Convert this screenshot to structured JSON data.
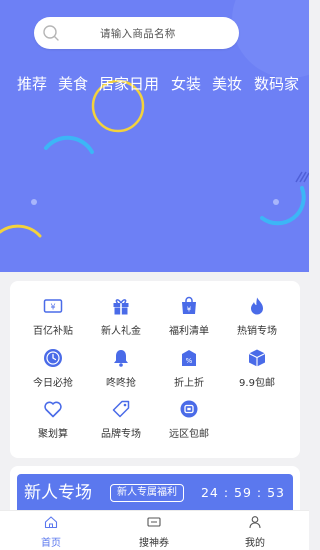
{
  "colors": {
    "accent": "#5b78ee",
    "hero_background": "#6d80f5",
    "ring": "#f3d23c"
  },
  "search": {
    "placeholder": "请输入商品名称",
    "icon": "search-icon"
  },
  "category_tabs": [
    {
      "label": "推荐"
    },
    {
      "label": "美食"
    },
    {
      "label": "居家日用"
    },
    {
      "label": "女装"
    },
    {
      "label": "美妆"
    },
    {
      "label": "数码家"
    }
  ],
  "grid": {
    "items": [
      {
        "label": "百亿补贴",
        "icon": "ticket-icon"
      },
      {
        "label": "新人礼金",
        "icon": "gift-icon"
      },
      {
        "label": "福利清单",
        "icon": "bag-icon"
      },
      {
        "label": "热销专场",
        "icon": "flame-icon"
      },
      {
        "label": "今日必抢",
        "icon": "clock-icon"
      },
      {
        "label": "咚咚抢",
        "icon": "bell-icon"
      },
      {
        "label": "折上折",
        "icon": "discount-tag-icon"
      },
      {
        "label": "9.9包邮",
        "icon": "package-icon"
      },
      {
        "label": "聚划算",
        "icon": "heart-icon"
      },
      {
        "label": "品牌专场",
        "icon": "tag-icon"
      },
      {
        "label": "远区包邮",
        "icon": "coupon-icon"
      }
    ]
  },
  "new_user": {
    "title": "新人专场",
    "badge": "新人专属福利",
    "countdown": "24 : 59 : 53"
  },
  "tabbar": {
    "items": [
      {
        "label": "首页",
        "icon": "home-icon",
        "active": true
      },
      {
        "label": "搜神券",
        "icon": "ticket-search-icon",
        "active": false
      },
      {
        "label": "我的",
        "icon": "user-icon",
        "active": false
      }
    ]
  }
}
